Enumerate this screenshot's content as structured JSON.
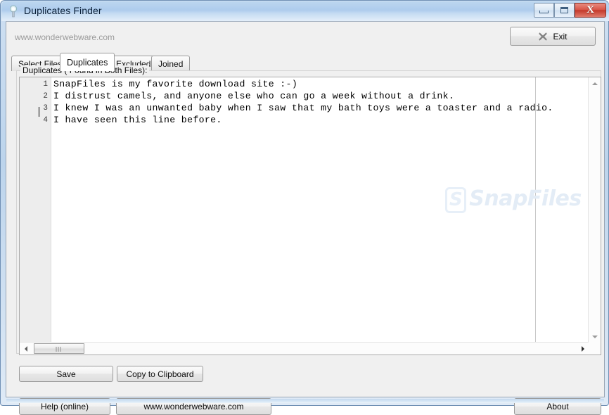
{
  "window": {
    "title": "Duplicates Finder",
    "title_icon": "magnifier-lamp-icon",
    "controls": {
      "minimize": "minimize-icon",
      "maximize": "maximize-icon",
      "close": "X"
    }
  },
  "header": {
    "url_label": "www.wonderwebware.com",
    "exit_button": "Exit",
    "exit_icon": "x-mark-icon"
  },
  "tabs": [
    {
      "label": "Select Files",
      "active": false
    },
    {
      "label": "Duplicates",
      "active": true
    },
    {
      "label": "Excluded",
      "active": false
    },
    {
      "label": "Joined",
      "active": false
    }
  ],
  "group": {
    "label": "Duplicates ( Found in Both Files):"
  },
  "editor": {
    "watermark": "SnapFiles",
    "watermark_mark": "S",
    "line_numbers": [
      "1",
      "2",
      "3",
      "4"
    ],
    "lines": [
      "SnapFiles is my favorite download site :-)",
      "I distrust camels, and anyone else who can go a week without a drink.",
      "I knew I was an unwanted baby when I saw that my bath toys were a toaster and a radio.",
      "I have seen this line before."
    ]
  },
  "scrollbars": {
    "v_up": "scroll-up-arrow",
    "v_down": "scroll-down-arrow",
    "h_left": "scroll-left-arrow",
    "h_right": "scroll-right-arrow"
  },
  "actions": {
    "save": "Save",
    "copy_clipboard": "Copy to Clipboard",
    "help": "Help (online)",
    "website": "www.wonderwebware.com",
    "about": "About"
  },
  "colors": {
    "titlebar_top": "#bcd6ef",
    "titlebar_bottom": "#e4eef9",
    "close_button": "#c33a2c",
    "client_bg": "#f0f0f0",
    "editor_bg": "#ffffff",
    "gutter_bg": "#ededed",
    "watermark": "#e3ecf6",
    "url_text": "#9a9a9a"
  }
}
